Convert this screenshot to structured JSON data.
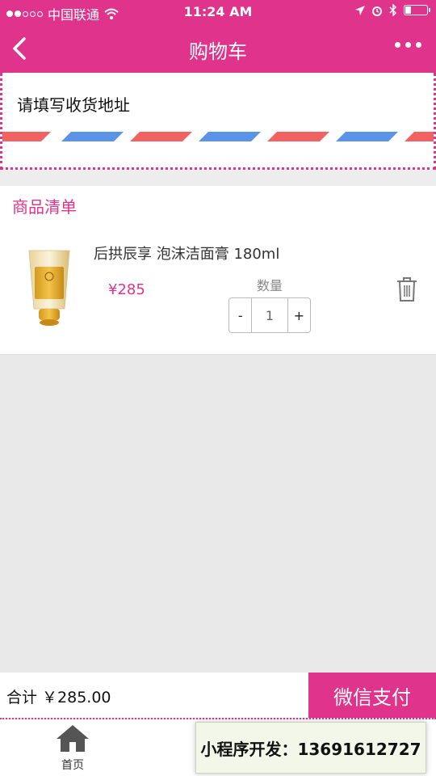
{
  "status_bar": {
    "carrier": "中国联通",
    "time": "11:24 AM"
  },
  "nav": {
    "title": "购物车"
  },
  "address": {
    "prompt": "请填写收货地址"
  },
  "list": {
    "title": "商品清单",
    "items": [
      {
        "name": "后拱辰享 泡沫洁面膏 180ml",
        "price": "¥285",
        "qty_label": "数量",
        "minus": "-",
        "qty": "1",
        "plus": "+"
      }
    ]
  },
  "footer": {
    "total": "合计 ￥285.00",
    "pay_label": "微信支付"
  },
  "tabbar": {
    "home_label": "首页"
  },
  "overlay": {
    "ad_text": "小程序开发：13691612727"
  },
  "colors": {
    "brand": "#e0338c",
    "stripe_red": "#f26262",
    "stripe_blue": "#5a93e8"
  }
}
